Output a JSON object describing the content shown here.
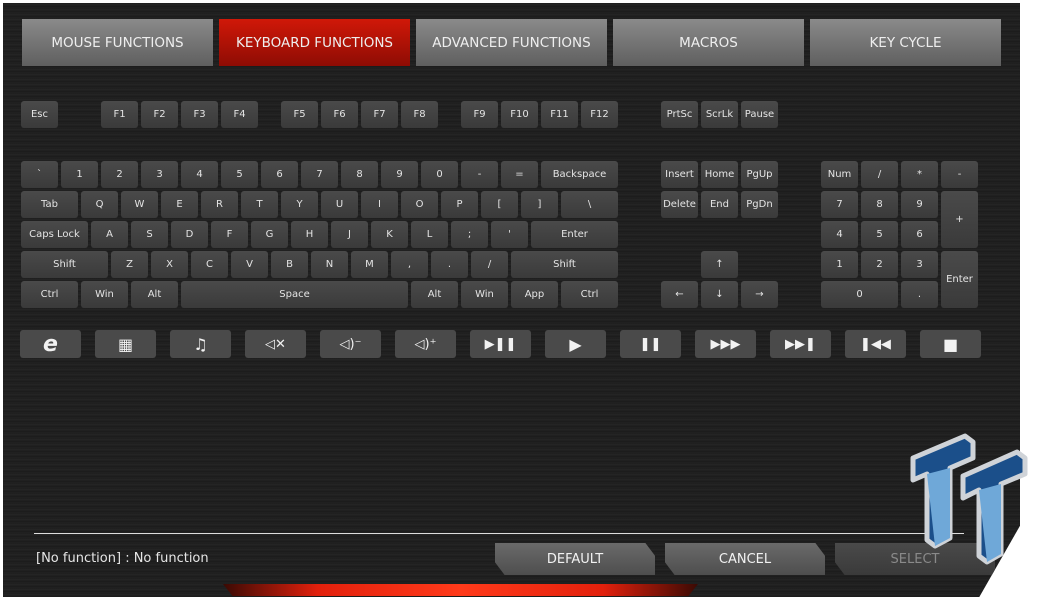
{
  "tabs": [
    {
      "label": "MOUSE FUNCTIONS",
      "active": false
    },
    {
      "label": "KEYBOARD FUNCTIONS",
      "active": true
    },
    {
      "label": "ADVANCED FUNCTIONS",
      "active": false
    },
    {
      "label": "MACROS",
      "active": false
    },
    {
      "label": "KEY CYCLE",
      "active": false
    }
  ],
  "keys": {
    "function_row": [
      "Esc",
      "F1",
      "F2",
      "F3",
      "F4",
      "F5",
      "F6",
      "F7",
      "F8",
      "F9",
      "F10",
      "F11",
      "F12",
      "PrtSc",
      "ScrLk",
      "Pause"
    ],
    "row1": [
      "`",
      "1",
      "2",
      "3",
      "4",
      "5",
      "6",
      "7",
      "8",
      "9",
      "0",
      "-",
      "=",
      "Backspace"
    ],
    "row2": [
      "Tab",
      "Q",
      "W",
      "E",
      "R",
      "T",
      "Y",
      "U",
      "I",
      "O",
      "P",
      "[",
      "]",
      "\\"
    ],
    "row3": [
      "Caps Lock",
      "A",
      "S",
      "D",
      "F",
      "G",
      "H",
      "J",
      "K",
      "L",
      ";",
      "'",
      "Enter"
    ],
    "row4": [
      "Shift",
      "Z",
      "X",
      "C",
      "V",
      "B",
      "N",
      "M",
      ",",
      ".",
      "/",
      "Shift"
    ],
    "row5": [
      "Ctrl",
      "Win",
      "Alt",
      "Space",
      "Alt",
      "Win",
      "App",
      "Ctrl"
    ],
    "nav": [
      "Insert",
      "Home",
      "PgUp",
      "Delete",
      "End",
      "PgDn",
      "↑",
      "←",
      "↓",
      "→"
    ],
    "numpad": [
      "Num",
      "/",
      "*",
      "-",
      "7",
      "8",
      "9",
      "+",
      "4",
      "5",
      "6",
      "1",
      "2",
      "3",
      "Enter",
      "0",
      "."
    ]
  },
  "media_buttons": [
    {
      "icon": "internet-explorer-icon",
      "glyph": "e"
    },
    {
      "icon": "calculator-icon",
      "glyph": "▦"
    },
    {
      "icon": "music-icon",
      "glyph": "♫"
    },
    {
      "icon": "mute-icon",
      "glyph": "◁✕"
    },
    {
      "icon": "volume-down-icon",
      "glyph": "◁)⁻"
    },
    {
      "icon": "volume-up-icon",
      "glyph": "◁)⁺"
    },
    {
      "icon": "play-pause-icon",
      "glyph": "▶❚❚"
    },
    {
      "icon": "play-icon",
      "glyph": "▶"
    },
    {
      "icon": "pause-icon",
      "glyph": "❚❚"
    },
    {
      "icon": "fast-forward-icon",
      "glyph": "▶▶▶"
    },
    {
      "icon": "next-track-icon",
      "glyph": "▶▶❚"
    },
    {
      "icon": "previous-track-icon",
      "glyph": "❚◀◀"
    },
    {
      "icon": "stop-icon",
      "glyph": "■"
    }
  ],
  "status_text": "[No function] : No function",
  "buttons": {
    "default": "DEFAULT",
    "cancel": "CANCEL",
    "select": "SELECT"
  },
  "colors": {
    "accent": "#c81408",
    "key": "#424242",
    "background": "#1f1f1f"
  }
}
